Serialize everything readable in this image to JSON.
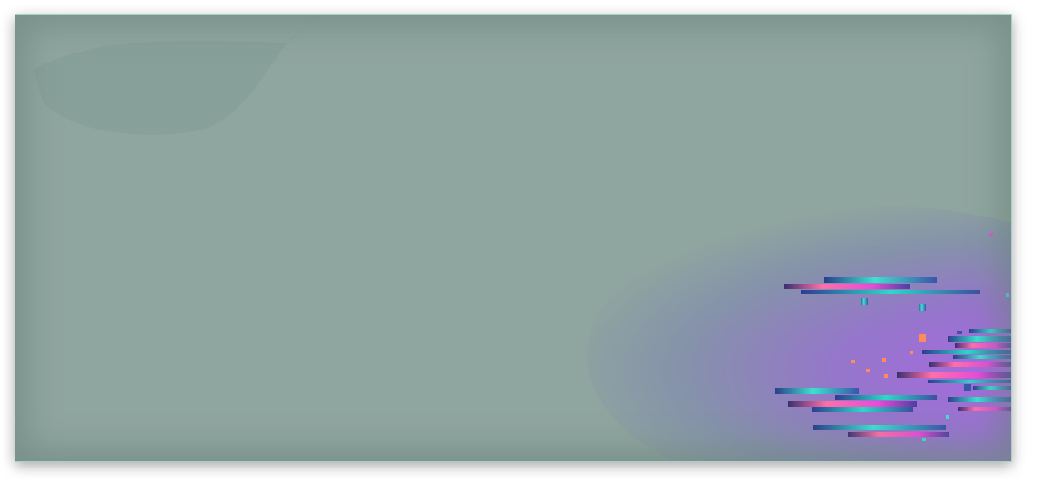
{
  "window": {
    "background_color": "#8fa59f",
    "border_color": "#a9cfc6"
  },
  "decor": {
    "leaf_icon": "leaf-silhouette",
    "glow_color": "#9b6bd6",
    "glitch_colors": [
      "#3fe0d0",
      "#ff6fa8",
      "#e84cd8",
      "#3a55a8",
      "#ff8a5c"
    ]
  }
}
